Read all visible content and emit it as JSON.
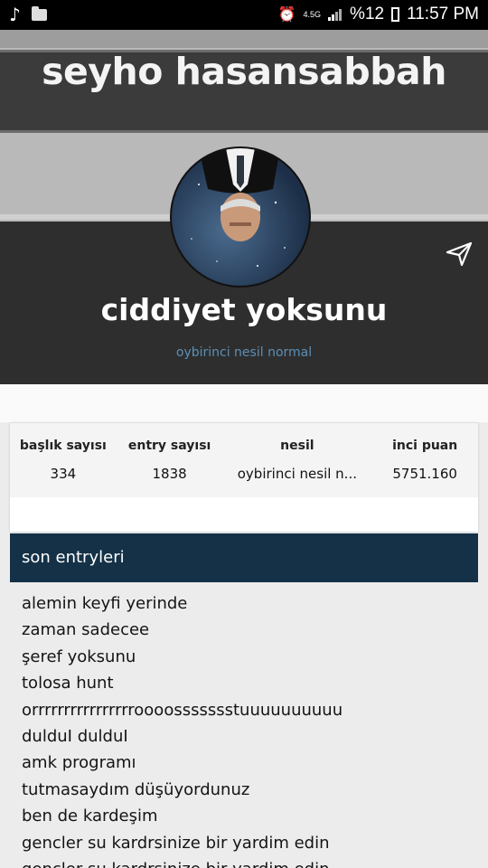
{
  "status_bar": {
    "network": "4.5G",
    "battery": "%12",
    "time": "11:57 PM"
  },
  "cover": {
    "text": "seyho hasansabbah"
  },
  "profile": {
    "name": "ciddiyet yoksunu",
    "subtitle": "oybirinci nesil normal"
  },
  "stats": [
    {
      "label": "başlık sayısı",
      "value": "334"
    },
    {
      "label": "entry sayısı",
      "value": "1838"
    },
    {
      "label": "nesil",
      "value": "oybirinci nesil n..."
    },
    {
      "label": "inci puan",
      "value": "5751.160"
    }
  ],
  "entries": {
    "title": "son entryleri",
    "items": [
      "alemin keyfi yerinde",
      "zaman sadecee",
      "şeref yoksunu",
      "tolosa hunt",
      "orrrrrrrrrrrrrrrroooossssssstuuuuuuuuuu",
      "dulduI dulduI",
      "amk programı",
      "tutmasaydım düşüyordunuz",
      "ben de kardeşim",
      "gencler su kardrsinize bir yardim edin",
      "gencler su kardrsinize bir yardim edin"
    ]
  }
}
